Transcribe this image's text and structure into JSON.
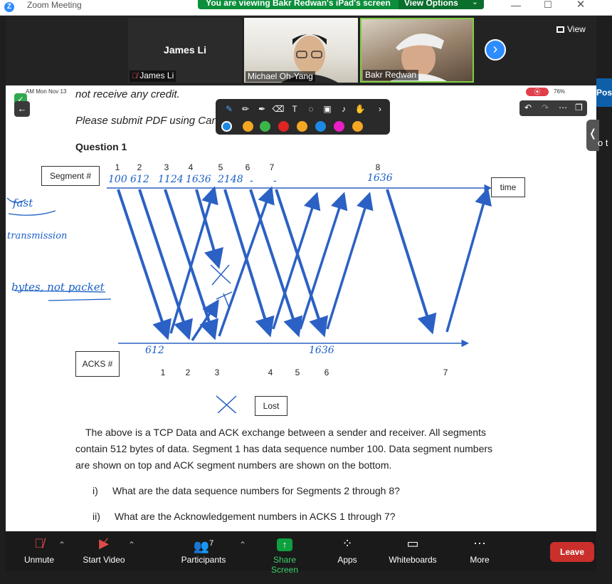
{
  "window": {
    "title": "Zoom Meeting",
    "share_banner": "You are viewing Bakr Redwan's iPad's screen",
    "view_options": "View Options"
  },
  "participants": [
    {
      "name": "James Li",
      "display": "James Li",
      "muted": true
    },
    {
      "name": "Michael Oh-Yang"
    },
    {
      "name": "Bakr Redwan"
    }
  ],
  "view_label": "View",
  "tablet_status": {
    "time": "AM  Mon Nov 13",
    "battery": "76%"
  },
  "doc": {
    "line_credit": "not receive any credit.",
    "line_submit": "Please submit PDF using Canv",
    "question": "Question 1",
    "segment_label": "Segment #",
    "time_label": "time",
    "acks_label": "ACKS #",
    "lost_label": "Lost",
    "segment_numbers": [
      "1",
      "2",
      "3",
      "4",
      "5",
      "6",
      "7",
      "8"
    ],
    "ack_numbers": [
      "1",
      "2",
      "3",
      "4",
      "5",
      "6",
      "7"
    ],
    "paragraph": [
      "The above is a TCP Data and ACK exchange between a sender and receiver.  All segments",
      "contain 512 bytes of data. Segment 1 has data sequence number 100.  Data segment numbers",
      "are shown on top and ACK segment numbers are shown on the bottom."
    ],
    "q_i_num": "i)",
    "q_i": "What are the data sequence numbers for Segments 2 through 8?",
    "q_ii_num": "ii)",
    "q_ii": "What are the Acknowledgement numbers in ACKS 1 through 7?"
  },
  "ink": {
    "seq_top": [
      "100",
      "612",
      "1124",
      "1636",
      "2148",
      "-",
      "-",
      "1636"
    ],
    "ack_bottom": [
      "612",
      "1636"
    ],
    "note1": "fast",
    "note2": "transmission",
    "note3": "bytes, not packet"
  },
  "toolbar": {
    "swatches": [
      "#f5a623",
      "#f5a623",
      "#3bb54a",
      "#e02424",
      "#f5a623",
      "#1e88e5",
      "#e91ec4",
      "#f5a623"
    ]
  },
  "bottom_bar": {
    "unmute": "Unmute",
    "start_video": "Start Video",
    "participants": "Participants",
    "participant_count": "7",
    "share_screen": "Share Screen",
    "apps": "Apps",
    "whiteboards": "Whiteboards",
    "more": "More",
    "leave": "Leave"
  },
  "right_edge": {
    "label": "Pos",
    "fragment": "o t"
  }
}
